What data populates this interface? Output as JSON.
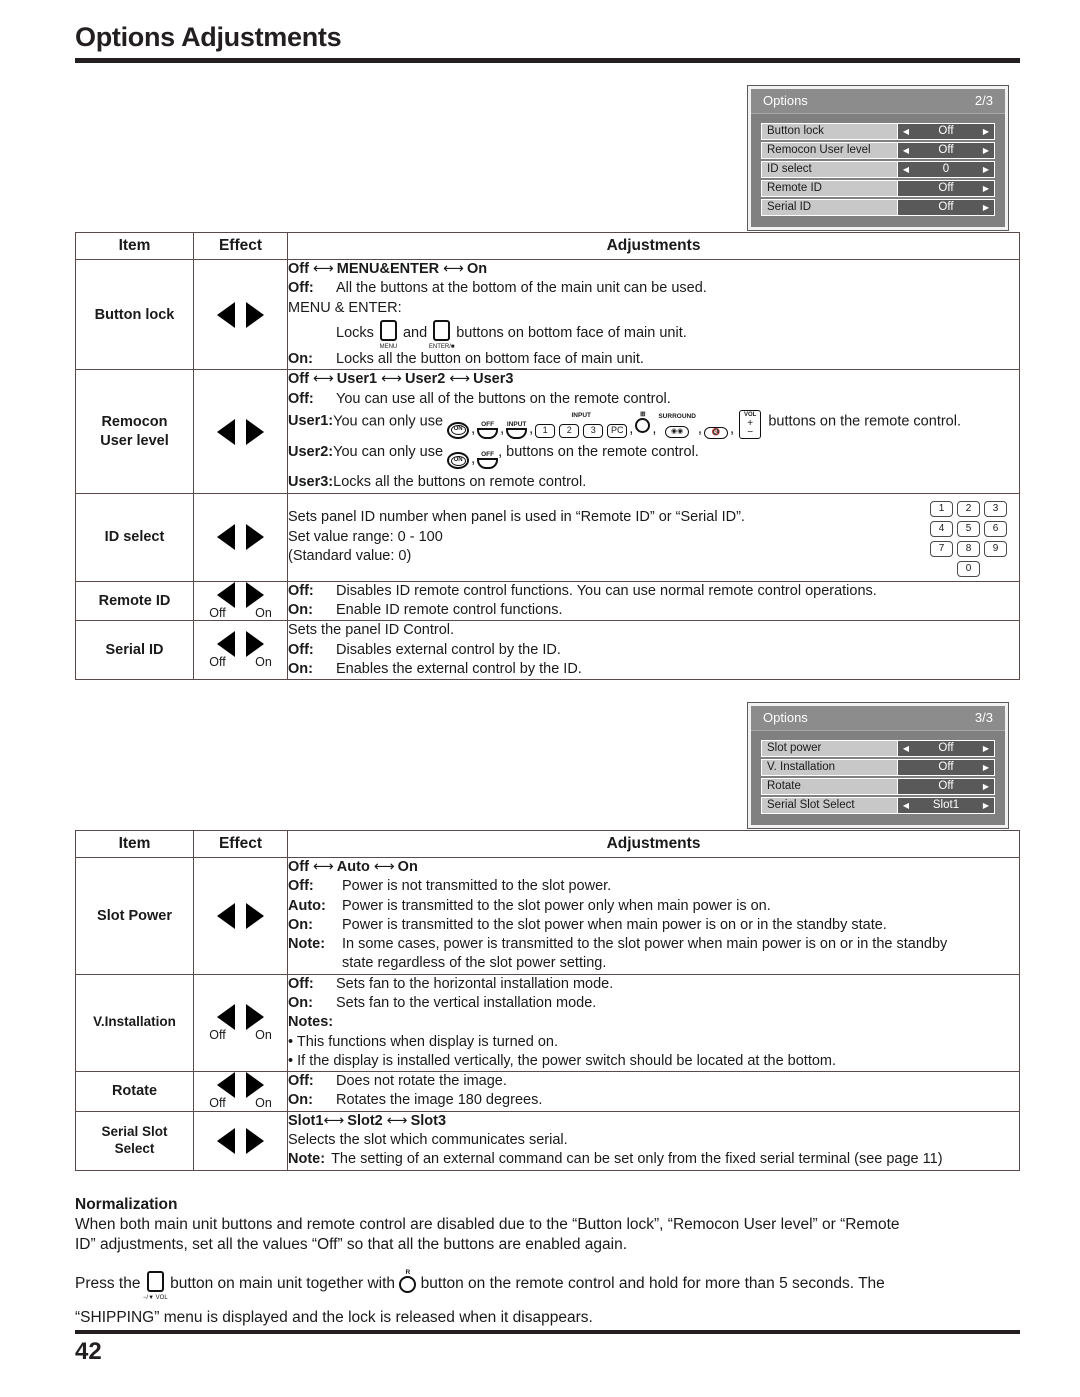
{
  "page": {
    "title": "Options Adjustments",
    "number": "42"
  },
  "osd_panels": [
    {
      "title": "Options",
      "pager": "2/3",
      "rows": [
        {
          "label": "Button lock",
          "value": "Off",
          "left_arrow": true,
          "right_arrow": true
        },
        {
          "label": "Remocon User level",
          "value": "Off",
          "left_arrow": true,
          "right_arrow": true
        },
        {
          "label": "ID select",
          "value": "0",
          "left_arrow": true,
          "right_arrow": true
        },
        {
          "label": "Remote ID",
          "value": "Off",
          "left_arrow": false,
          "right_arrow": true
        },
        {
          "label": "Serial ID",
          "value": "Off",
          "left_arrow": false,
          "right_arrow": true
        }
      ]
    },
    {
      "title": "Options",
      "pager": "3/3",
      "rows": [
        {
          "label": "Slot power",
          "value": "Off",
          "left_arrow": true,
          "right_arrow": true
        },
        {
          "label": "V. Installation",
          "value": "Off",
          "left_arrow": false,
          "right_arrow": true
        },
        {
          "label": "Rotate",
          "value": "Off",
          "left_arrow": false,
          "right_arrow": true
        },
        {
          "label": "Serial Slot Select",
          "value": "Slot1",
          "left_arrow": true,
          "right_arrow": true
        }
      ]
    }
  ],
  "table_headers": {
    "item": "Item",
    "effect": "Effect",
    "adjustments": "Adjustments"
  },
  "table1": {
    "button_lock": {
      "item": "Button lock",
      "cycle": {
        "a": "Off",
        "b": "MENU&ENTER",
        "c": "On"
      },
      "off_label": "Off:",
      "off_text": "All the buttons at the bottom of the main unit can be used.",
      "menu_enter_label": "MENU & ENTER:",
      "locks_prefix": "Locks",
      "locks_middle": "and",
      "locks_suffix": "buttons on bottom face of main unit.",
      "btn1_caption": "MENU",
      "btn2_caption": "ENTER/■",
      "on_label": "On:",
      "on_text": "Locks all the button on bottom face of main unit."
    },
    "remocon": {
      "item_line1": "Remocon",
      "item_line2": "User level",
      "cycle": {
        "a": "Off",
        "b": "User1",
        "c": "User2",
        "d": "User3"
      },
      "off_label": "Off:",
      "off_text": "You can use all of the buttons on the remote control.",
      "user1_label": "User1:",
      "user1_prefix": "You can only use",
      "user1_suffix": "buttons on the remote control.",
      "user2_label": "User2:",
      "user2_prefix": "You can only use",
      "user2_suffix": ", buttons on the remote control.",
      "user3_label": "User3:",
      "user3_text": "Locks all the buttons on remote control.",
      "remote_glyphs": {
        "on": "ON",
        "off": "OFF",
        "input": "INPUT",
        "input_group": "INPUT",
        "numbers": [
          "1",
          "2",
          "3",
          "PC"
        ],
        "surround": "SURROUND",
        "vol": "VOL",
        "vol_plus": "+",
        "vol_minus": "−"
      }
    },
    "id_select": {
      "item": "ID select",
      "line1": "Sets panel ID number when panel is used in “Remote ID” or “Serial ID”.",
      "line2": "Set value range: 0 - 100",
      "line3": "(Standard value: 0)",
      "keypad": [
        "1",
        "2",
        "3",
        "4",
        "5",
        "6",
        "7",
        "8",
        "9",
        "0"
      ]
    },
    "remote_id": {
      "item": "Remote ID",
      "arrow_left_label": "Off",
      "arrow_right_label": "On",
      "off_label": "Off:",
      "off_text": "Disables ID remote control functions. You can use normal remote control operations.",
      "on_label": "On:",
      "on_text": "Enable ID remote control functions."
    },
    "serial_id": {
      "item": "Serial ID",
      "arrow_left_label": "Off",
      "arrow_right_label": "On",
      "intro": "Sets the panel ID Control.",
      "off_label": "Off:",
      "off_text": "Disables external control by the ID.",
      "on_label": "On:",
      "on_text": "Enables the external control by the ID."
    }
  },
  "table2": {
    "slot_power": {
      "item": "Slot Power",
      "cycle": {
        "a": "Off",
        "b": "Auto",
        "c": "On"
      },
      "off_label": "Off:",
      "off_text": "Power is not transmitted to the slot power.",
      "auto_label": "Auto:",
      "auto_text": "Power is transmitted to the slot power only when main power is on.",
      "on_label": "On:",
      "on_text": "Power is transmitted to the slot power when main power is on or in the standby state.",
      "note_label": "Note:",
      "note_text": "In some cases, power is transmitted to the slot power when main power is on or in the standby",
      "note_text2": "state regardless of the slot power setting."
    },
    "v_installation": {
      "item": "V.Installation",
      "arrow_left_label": "Off",
      "arrow_right_label": "On",
      "off_label": "Off:",
      "off_text": "Sets fan to the horizontal installation mode.",
      "on_label": "On:",
      "on_text": "Sets fan to the vertical installation mode.",
      "notes_label": "Notes:",
      "note1": "• This functions when display is turned on.",
      "note2": "• If the display is installed vertically, the power switch should be located at the bottom."
    },
    "rotate": {
      "item": "Rotate",
      "arrow_left_label": "Off",
      "arrow_right_label": "On",
      "off_label": "Off:",
      "off_text": "Does not rotate the image.",
      "on_label": "On:",
      "on_text": "Rotates the image 180 degrees."
    },
    "serial_slot_select": {
      "item_line1": "Serial Slot",
      "item_line2": "Select",
      "cycle": {
        "a": "Slot1",
        "b": "Slot2",
        "c": "Slot3"
      },
      "desc": "Selects the slot which communicates serial.",
      "note_label": "Note:",
      "note_text": "The setting of an external command can be set only from the fixed serial terminal (see page 11)"
    }
  },
  "normalization": {
    "title": "Normalization",
    "para1_line1": "When both main unit buttons and remote control are disabled due to the “Button lock”, “Remocon User level” or “Remote",
    "para1_line2": "ID” adjustments, set all the values “Off” so that all the buttons are enabled again.",
    "para2_a": "Press the",
    "para2_b": "button on main unit together with",
    "para2_c": "button on the remote control and hold for more than 5 seconds. The",
    "para2_d": "“SHIPPING” menu is displayed and the lock is released when it disappears.",
    "vol_button_caption": "−/▼ VOL",
    "r_button_caption": "R"
  }
}
